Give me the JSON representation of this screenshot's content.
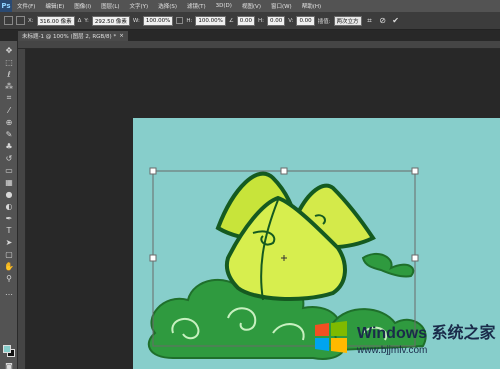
{
  "app": {
    "logo": "Ps"
  },
  "menubar": {
    "items": [
      "文件(F)",
      "编辑(E)",
      "图像(I)",
      "图层(L)",
      "文字(Y)",
      "选择(S)",
      "滤镜(T)",
      "3D(D)",
      "视图(V)",
      "窗口(W)",
      "帮助(H)"
    ]
  },
  "options": {
    "x_label": "X:",
    "x_value": "316.00 像素",
    "y_label": "Y:",
    "y_value": "292.50 像素",
    "w_label": "W:",
    "w_value": "100.00%",
    "h_label": "H:",
    "h_value": "100.00%",
    "angle_value": "0.00",
    "hskew_label": "H:",
    "hskew_value": "0.00",
    "vskew_label": "V:",
    "vskew_value": "0.00",
    "interp_label": "插值:",
    "interp_value": "两次立方"
  },
  "document": {
    "tab_title": "未标题-1 @ 100% (图层 2, RGB/8) *"
  },
  "watermark": {
    "title": "Windows 系统之家",
    "url": "www.bjjmlv.com"
  },
  "colors": {
    "canvas_bg": "#87cecb",
    "foreground": "#87cecb",
    "background": "#111111"
  }
}
